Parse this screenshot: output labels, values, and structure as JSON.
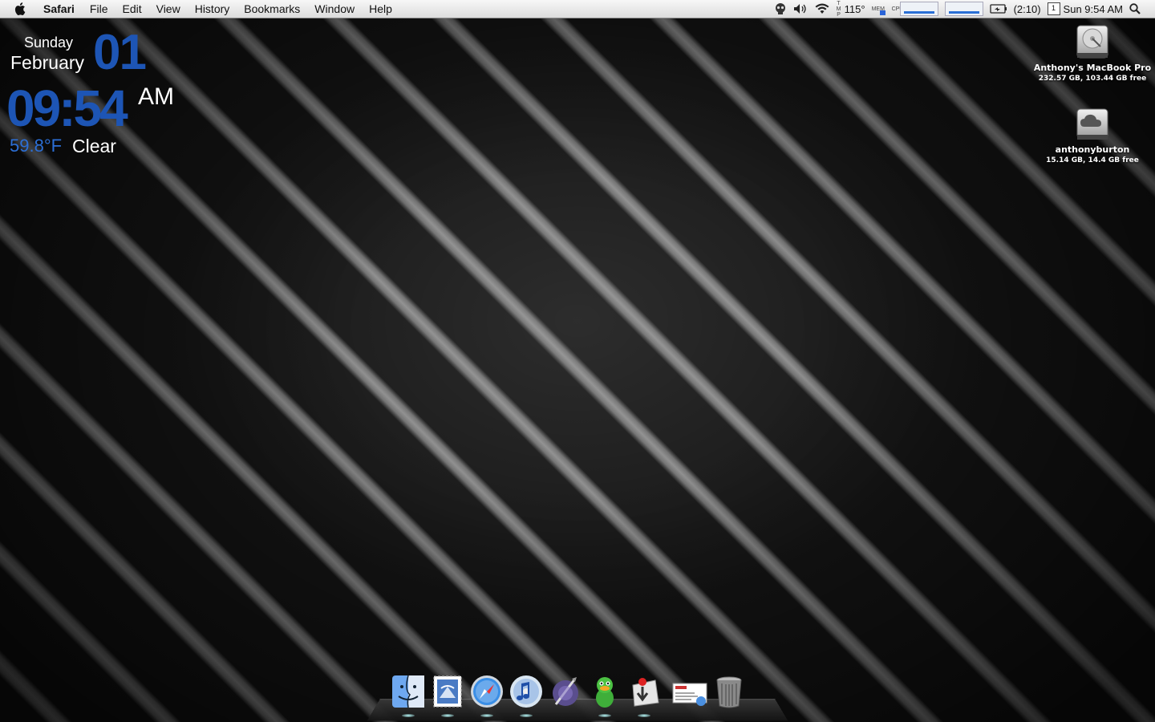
{
  "menubar": {
    "app_name": "Safari",
    "items": [
      "File",
      "Edit",
      "View",
      "History",
      "Bookmarks",
      "Window",
      "Help"
    ],
    "status": {
      "temperature": "115°",
      "mem_label": "MEM",
      "cpu_label": "CPU",
      "battery": "(2:10)",
      "calendar_day": "1",
      "clock": "Sun 9:54 AM"
    }
  },
  "widget": {
    "day": "Sunday",
    "month": "February",
    "date": "01",
    "time": "09:54",
    "ampm": "AM",
    "temperature": "59.8°F",
    "condition": "Clear"
  },
  "desktop_icons": [
    {
      "name": "Anthony's MacBook Pro",
      "info": "232.57 GB, 103.44 GB free"
    },
    {
      "name": "anthonyburton",
      "info": "15.14 GB, 14.4 GB free"
    }
  ],
  "dock": {
    "items": [
      "Finder",
      "Mail",
      "Safari",
      "iTunes",
      "Script Editor",
      "Adium",
      "Transmission",
      "Mail Message",
      "Trash"
    ]
  },
  "colors": {
    "accent_blue": "#1d55b5",
    "temp_blue": "#2c6fd6"
  }
}
